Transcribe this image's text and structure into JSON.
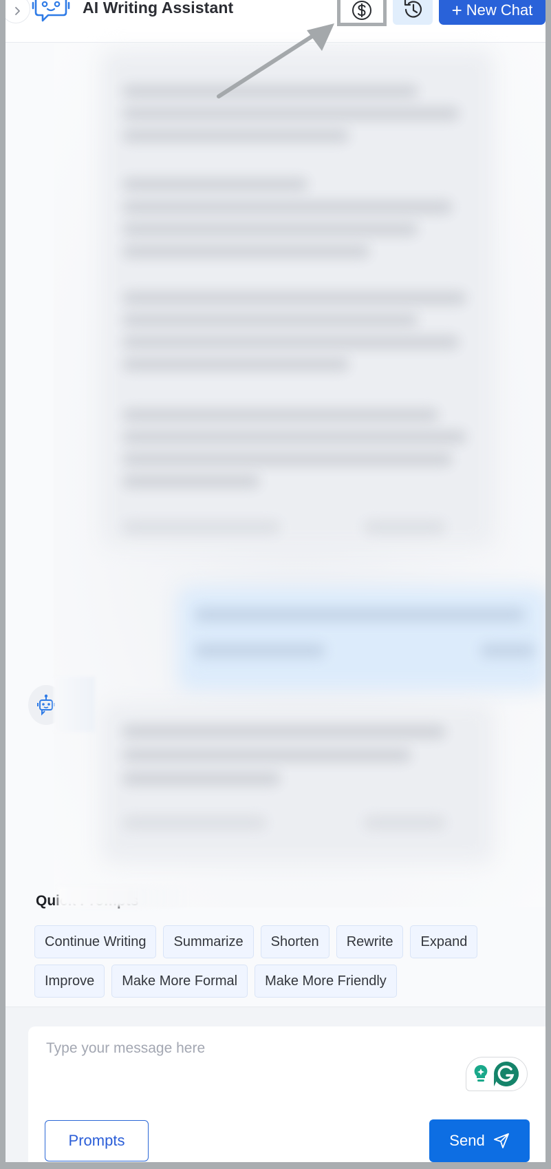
{
  "header": {
    "title": "AI Writing Assistant",
    "new_chat_label": "New Chat",
    "icons": {
      "collapse": "chevron-right-icon",
      "logo": "chat-bot-logo-icon",
      "billing": "dollar-circle-icon",
      "history": "history-icon",
      "new_chat": "plus-icon"
    }
  },
  "chat": {
    "messages_redacted": true,
    "bot_avatar_icon": "robot-icon"
  },
  "quick_prompts": {
    "title": "Quick Prompts",
    "items": [
      {
        "label": "Continue Writing"
      },
      {
        "label": "Summarize"
      },
      {
        "label": "Shorten"
      },
      {
        "label": "Rewrite"
      },
      {
        "label": "Expand"
      },
      {
        "label": "Improve"
      },
      {
        "label": "Make More Formal"
      },
      {
        "label": "Make More Friendly"
      }
    ]
  },
  "composer": {
    "placeholder": "Type your message here",
    "value": "",
    "prompts_label": "Prompts",
    "send_label": "Send",
    "send_icon": "paper-plane-icon",
    "extension_icons": [
      "lightbulb-icon",
      "grammarly-icon"
    ]
  },
  "colors": {
    "primary": "#2962d9",
    "send": "#0d6ee3",
    "chip_bg": "#f0f5ff",
    "history_bg": "#e1eefc",
    "grammarly": "#15846a"
  }
}
